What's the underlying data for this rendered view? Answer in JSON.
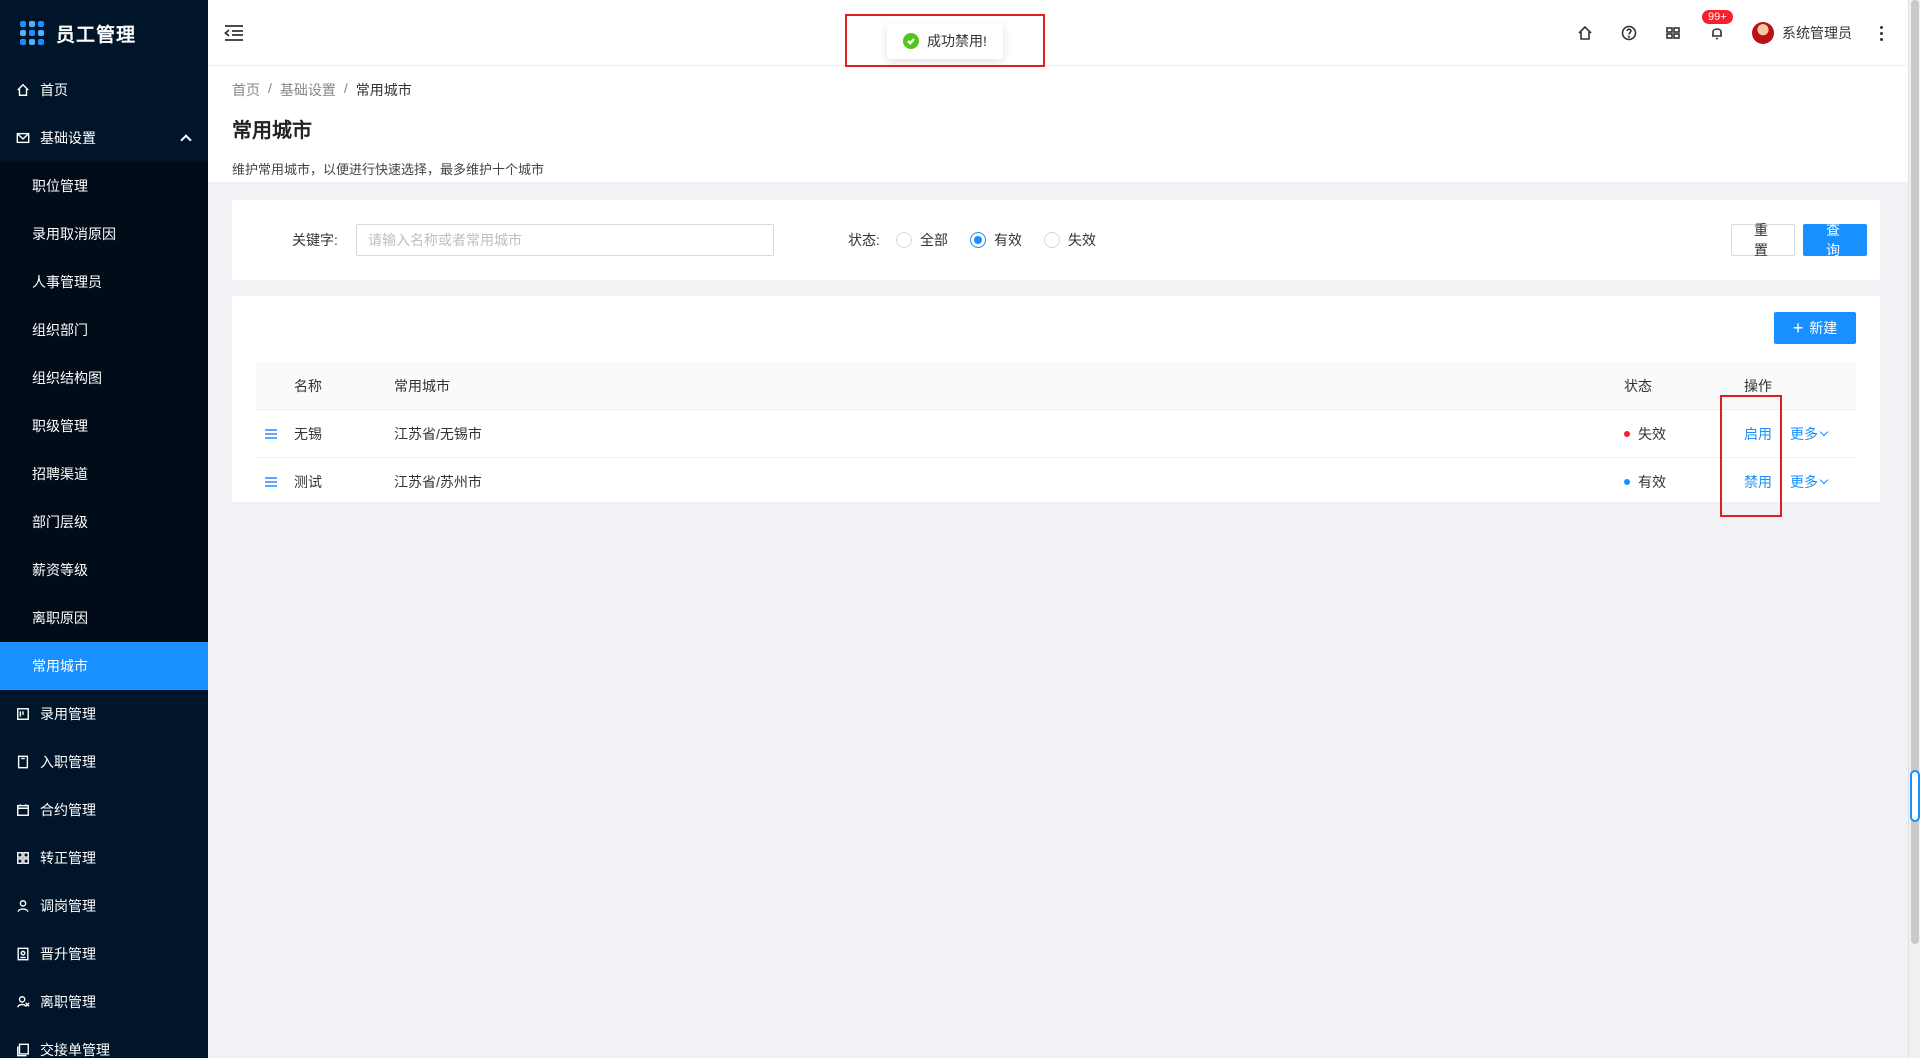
{
  "app": {
    "title": "员工管理"
  },
  "sidebar": {
    "items_top": [
      {
        "label": "首页",
        "icon": "home-icon"
      }
    ],
    "open_group": {
      "label": "基础设置",
      "icon": "mail-icon",
      "children": [
        {
          "label": "职位管理"
        },
        {
          "label": "录用取消原因"
        },
        {
          "label": "人事管理员"
        },
        {
          "label": "组织部门"
        },
        {
          "label": "组织结构图"
        },
        {
          "label": "职级管理"
        },
        {
          "label": "招聘渠道"
        },
        {
          "label": "部门层级"
        },
        {
          "label": "薪资等级"
        },
        {
          "label": "离职原因"
        },
        {
          "label": "常用城市",
          "active": true
        }
      ]
    },
    "items_bottom": [
      {
        "label": "录用管理",
        "icon": "offer-icon"
      },
      {
        "label": "入职管理",
        "icon": "onboard-icon"
      },
      {
        "label": "合约管理",
        "icon": "calendar-icon"
      },
      {
        "label": "转正管理",
        "icon": "grid-icon"
      },
      {
        "label": "调岗管理",
        "icon": "user-icon"
      },
      {
        "label": "晋升管理",
        "icon": "promotion-icon"
      },
      {
        "label": "离职管理",
        "icon": "resign-icon"
      },
      {
        "label": "交接单管理",
        "icon": "handover-icon"
      }
    ]
  },
  "header": {
    "notification_badge": "99+",
    "user_name": "系统管理员"
  },
  "toast": {
    "message": "成功禁用!"
  },
  "page": {
    "breadcrumb": [
      "首页",
      "基础设置",
      "常用城市"
    ],
    "title": "常用城市",
    "description": "维护常用城市，以便进行快速选择，最多维护十个城市"
  },
  "search": {
    "keyword_label": "关键字:",
    "keyword_placeholder": "请输入名称或者常用城市",
    "keyword_value": "",
    "status_label": "状态:",
    "status_options": [
      "全部",
      "有效",
      "失效"
    ],
    "status_selected": "有效",
    "reset_label": "重置",
    "query_label": "查询"
  },
  "table": {
    "new_label": "新建",
    "columns": [
      "名称",
      "常用城市",
      "状态",
      "操作"
    ],
    "rows": [
      {
        "name": "无锡",
        "city": "江苏省/无锡市",
        "status": "失效",
        "status_color": "#f5222d",
        "action": "启用",
        "more": "更多"
      },
      {
        "name": "测试",
        "city": "江苏省/苏州市",
        "status": "有效",
        "status_color": "#1890ff",
        "action": "禁用",
        "more": "更多"
      }
    ]
  },
  "colors": {
    "primary": "#1890ff",
    "sidebar_bg": "#001529",
    "success": "#52c41a",
    "danger": "#f5222d"
  }
}
